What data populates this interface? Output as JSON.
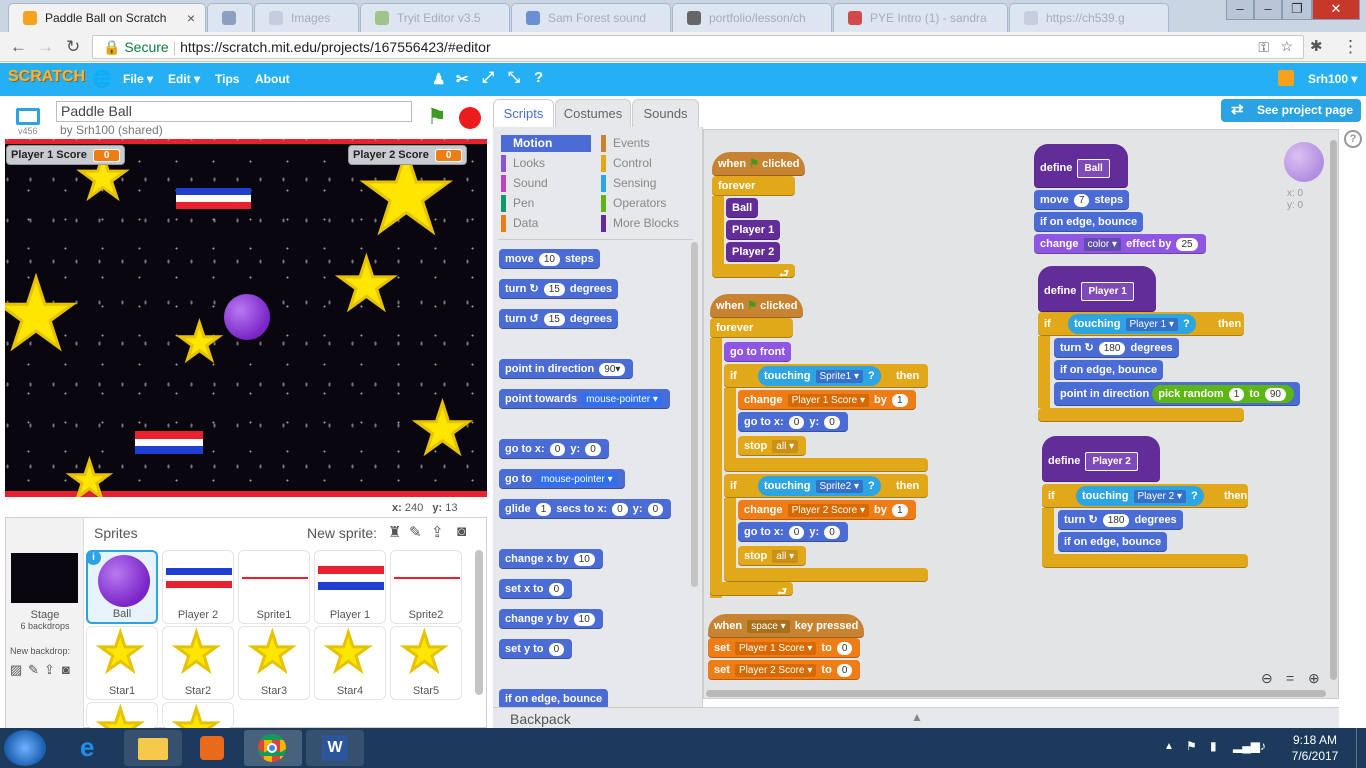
{
  "browser": {
    "tabs": [
      {
        "title": "Paddle Ball on Scratch"
      },
      {
        "title": "Images"
      },
      {
        "title": "Tryit Editor v3.5"
      },
      {
        "title": "Sam Forest sound"
      },
      {
        "title": "portfolio/lesson/ch"
      },
      {
        "title": "PYE Intro (1) - sandra"
      },
      {
        "title": "https://ch539.g"
      }
    ],
    "url_secure": "Secure",
    "url": "https://scratch.mit.edu/projects/167556423/#editor"
  },
  "menu": {
    "logo": "SCRATCH",
    "file": "File ▾",
    "edit": "Edit ▾",
    "tips": "Tips",
    "about": "About",
    "user": "Srh100 ▾"
  },
  "project": {
    "title": "Paddle Ball",
    "by": "by Srh100 (shared)",
    "version": "v456"
  },
  "stage": {
    "monitor1_label": "Player 1 Score",
    "monitor1_value": "0",
    "monitor2_label": "Player 2 Score",
    "monitor2_value": "0",
    "x_label": "x:",
    "x_value": "240",
    "y_label": "y:",
    "y_value": "13"
  },
  "tabs": {
    "scripts": "Scripts",
    "costumes": "Costumes",
    "sounds": "Sounds"
  },
  "see_project": "See project page",
  "categories": [
    {
      "name": "Motion",
      "color": "#4a6cd4"
    },
    {
      "name": "Events",
      "color": "#c88330"
    },
    {
      "name": "Looks",
      "color": "#8a55d7"
    },
    {
      "name": "Control",
      "color": "#e1a91a"
    },
    {
      "name": "Sound",
      "color": "#bb42c3"
    },
    {
      "name": "Sensing",
      "color": "#2ca5e2"
    },
    {
      "name": "Pen",
      "color": "#0e9a6c"
    },
    {
      "name": "Operators",
      "color": "#5cb712"
    },
    {
      "name": "Data",
      "color": "#ee7d16"
    },
    {
      "name": "More Blocks",
      "color": "#632d99"
    }
  ],
  "palette": {
    "move": "move",
    "move_v": "10",
    "steps": "steps",
    "turn": "turn",
    "degrees": "degrees",
    "turn1_v": "15",
    "turn2_v": "15",
    "point_dir": "point in direction",
    "point_dir_v": "90▾",
    "point_towards": "point towards",
    "mouse_pointer": "mouse-pointer ▾",
    "goto_x": "go to x:",
    "goto_y": "y:",
    "zero": "0",
    "goto": "go to",
    "glide": "glide",
    "glide_v": "1",
    "secs_to_x": "secs to x:",
    "change_x": "change x by",
    "change_x_v": "10",
    "set_x": "set x to",
    "change_y": "change y by",
    "change_y_v": "10",
    "set_y": "set y to",
    "edge": "if on edge, bounce"
  },
  "scripts": {
    "when": "when",
    "clicked": "clicked",
    "forever": "forever",
    "ball": "Ball",
    "player1": "Player 1",
    "player2": "Player 2",
    "go_front": "go to front",
    "if": "if",
    "touching": "touching",
    "then": "then",
    "sprite1": "Sprite1 ▾",
    "sprite2": "Sprite2 ▾",
    "q": "?",
    "change": "change",
    "p1score": "Player 1 Score ▾",
    "p2score": "Player 2 Score ▾",
    "by": "by",
    "one": "1",
    "goto_x": "go to x:",
    "y": "y:",
    "zero": "0",
    "stop": "stop",
    "all": "all ▾",
    "space": "space ▾",
    "key_pressed": "key pressed",
    "set": "set",
    "to": "to",
    "define": "define",
    "move": "move",
    "seven": "7",
    "steps": "steps",
    "edge": "if on edge, bounce",
    "color": "color ▾",
    "effect_by": "effect by",
    "effect_v": "25",
    "p1_dd": "Player 1 ▾",
    "p2_dd": "Player 2 ▾",
    "turn": "turn",
    "deg": "degrees",
    "n180": "180",
    "point_dir": "point in direction",
    "pick_random": "pick random",
    "rand_to": "to",
    "r1": "1",
    "r90": "90",
    "sprite_x": "x: 0",
    "sprite_y": "y: 0"
  },
  "sprites_panel": {
    "title": "Sprites",
    "new_sprite": "New sprite:",
    "stage": "Stage",
    "backdrops": "6 backdrops",
    "new_backdrop": "New backdrop:"
  },
  "sprites": [
    {
      "name": "Ball"
    },
    {
      "name": "Player 2"
    },
    {
      "name": "Sprite1"
    },
    {
      "name": "Player 1"
    },
    {
      "name": "Sprite2"
    },
    {
      "name": "Star1"
    },
    {
      "name": "Star2"
    },
    {
      "name": "Star3"
    },
    {
      "name": "Star4"
    },
    {
      "name": "Star5"
    }
  ],
  "backpack": "Backpack",
  "clock": {
    "time": "9:18 AM",
    "date": "7/6/2017"
  }
}
